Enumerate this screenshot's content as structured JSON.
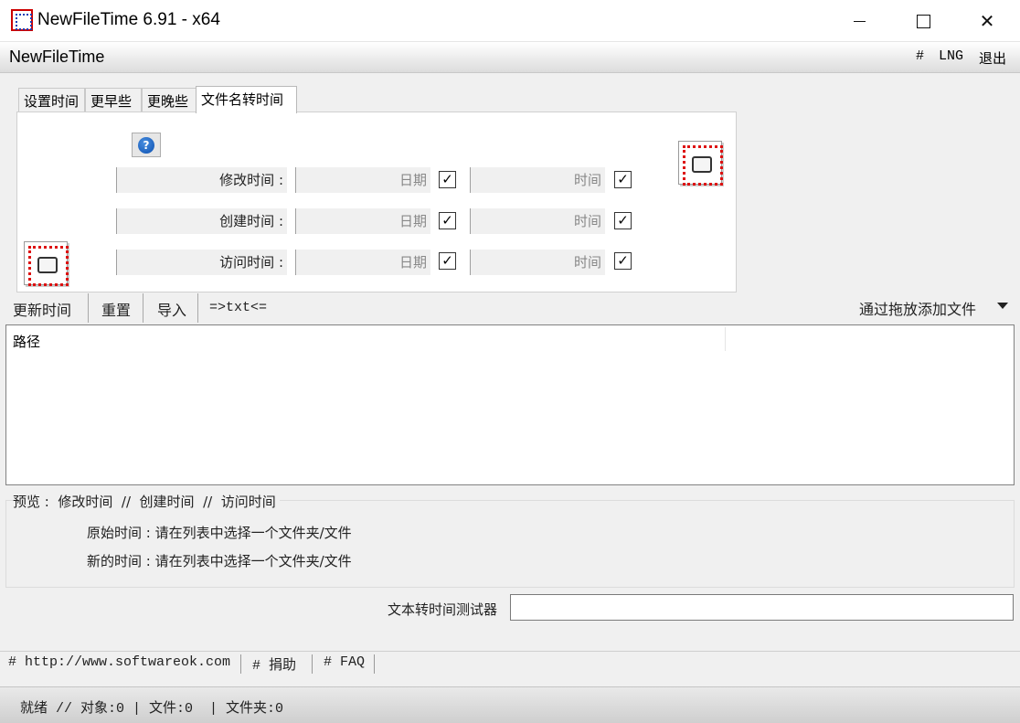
{
  "window": {
    "title": "NewFileTime 6.91 - x64",
    "minimize": "",
    "maximize": "",
    "close": "✕"
  },
  "header": {
    "app_name": "NewFileTime",
    "hash": "#",
    "language": "LNG",
    "exit": "退出"
  },
  "tabs": [
    {
      "label": "设置时间"
    },
    {
      "label": "更早些"
    },
    {
      "label": "更晚些"
    },
    {
      "label": "文件名转时间"
    }
  ],
  "panel": {
    "help": "?",
    "rows": [
      {
        "label": "修改时间 :",
        "date": "日期",
        "time": "时间",
        "date_checked": true,
        "time_checked": true
      },
      {
        "label": "创建时间 :",
        "date": "日期",
        "time": "时间",
        "date_checked": true,
        "time_checked": true
      },
      {
        "label": "访问时间 :",
        "date": "日期",
        "time": "时间",
        "date_checked": true,
        "time_checked": true
      }
    ]
  },
  "toolbar": {
    "update": "更新时间",
    "reset": "重置",
    "import": "导入",
    "txt": "=>txt<=",
    "drop": "通过拖放添加文件"
  },
  "filelist": {
    "column_path": "路径"
  },
  "preview": {
    "label": "预览 :  修改时间  //  创建时间  //  访问时间",
    "original": "原始时间 : 请在列表中选择一个文件夹/文件",
    "new": "新的时间 : 请在列表中选择一个文件夹/文件"
  },
  "tester": {
    "label": "文本转时间测试器",
    "value": ""
  },
  "links": {
    "website": "# http://www.softwareok.com",
    "donate": "# 捐助",
    "faq": "# FAQ"
  },
  "status": {
    "text": "就绪 // 对象:0 | 文件:0  | 文件夹:0"
  }
}
